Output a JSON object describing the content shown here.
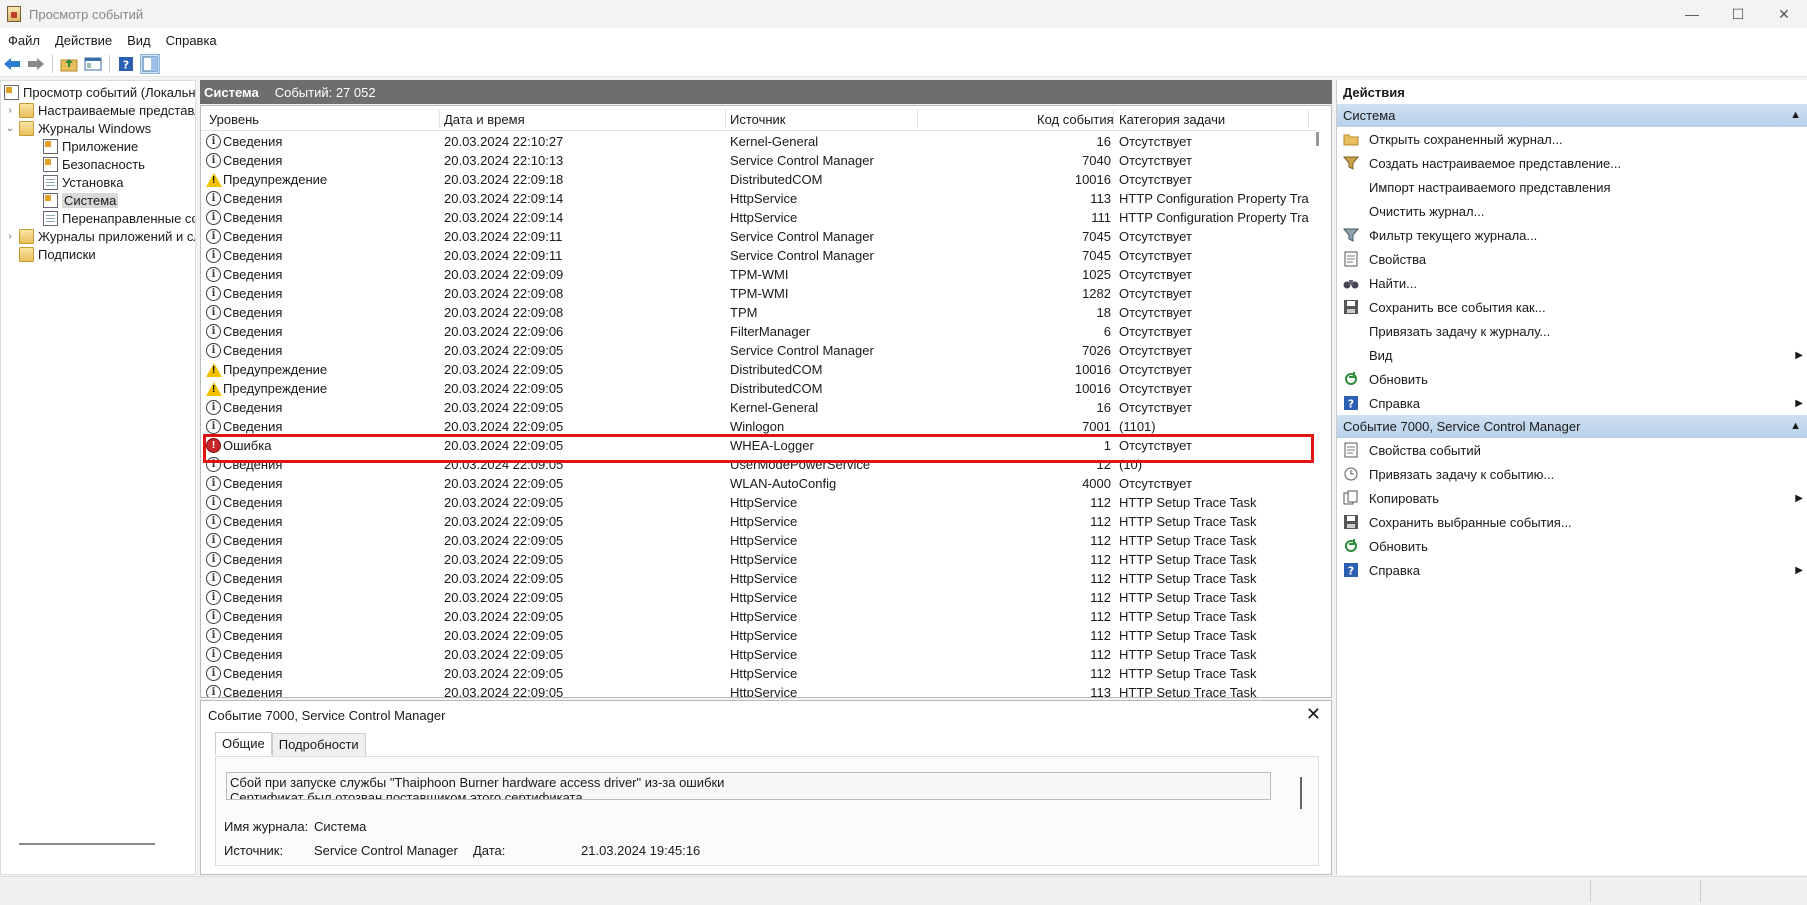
{
  "window": {
    "title": "Просмотр событий"
  },
  "window_controls": {
    "minimize": "—",
    "maximize": "☐",
    "close": "✕"
  },
  "menu": [
    "Файл",
    "Действие",
    "Вид",
    "Справка"
  ],
  "tree": {
    "items": [
      {
        "label": "Просмотр событий (Локальны",
        "level": 0,
        "arrow": "",
        "icon": "event-viewer-icon"
      },
      {
        "label": "Настраиваемые представле",
        "level": 1,
        "arrow": "›",
        "icon": "folder-icon"
      },
      {
        "label": "Журналы Windows",
        "level": 1,
        "arrow": "⌄",
        "icon": "folder-icon"
      },
      {
        "label": "Приложение",
        "level": 2,
        "arrow": "",
        "icon": "log-warning-icon"
      },
      {
        "label": "Безопасность",
        "level": 2,
        "arrow": "",
        "icon": "log-warning-icon"
      },
      {
        "label": "Установка",
        "level": 2,
        "arrow": "",
        "icon": "log-icon"
      },
      {
        "label": "Система",
        "level": 2,
        "arrow": "",
        "icon": "log-warning-icon",
        "selected": true
      },
      {
        "label": "Перенаправленные собы",
        "level": 2,
        "arrow": "",
        "icon": "log-icon"
      },
      {
        "label": "Журналы приложений и сл",
        "level": 1,
        "arrow": "›",
        "icon": "folder-icon"
      },
      {
        "label": "Подписки",
        "level": 1,
        "arrow": "",
        "icon": "folder-icon"
      }
    ]
  },
  "center": {
    "log_name": "Система",
    "count_text": "Событий: 27 052",
    "columns": [
      "Уровень",
      "Дата и время",
      "Источник",
      "Код события",
      "Категория задачи"
    ],
    "rows": [
      {
        "level": "info",
        "level_text": "Сведения",
        "date": "20.03.2024 22:10:27",
        "source": "Kernel-General",
        "id": "16",
        "category": "Отсутствует"
      },
      {
        "level": "info",
        "level_text": "Сведения",
        "date": "20.03.2024 22:10:13",
        "source": "Service Control Manager",
        "id": "7040",
        "category": "Отсутствует"
      },
      {
        "level": "warn",
        "level_text": "Предупреждение",
        "date": "20.03.2024 22:09:18",
        "source": "DistributedCOM",
        "id": "10016",
        "category": "Отсутствует"
      },
      {
        "level": "info",
        "level_text": "Сведения",
        "date": "20.03.2024 22:09:14",
        "source": "HttpService",
        "id": "113",
        "category": "HTTP Configuration Property Tra..."
      },
      {
        "level": "info",
        "level_text": "Сведения",
        "date": "20.03.2024 22:09:14",
        "source": "HttpService",
        "id": "111",
        "category": "HTTP Configuration Property Tra..."
      },
      {
        "level": "info",
        "level_text": "Сведения",
        "date": "20.03.2024 22:09:11",
        "source": "Service Control Manager",
        "id": "7045",
        "category": "Отсутствует"
      },
      {
        "level": "info",
        "level_text": "Сведения",
        "date": "20.03.2024 22:09:11",
        "source": "Service Control Manager",
        "id": "7045",
        "category": "Отсутствует"
      },
      {
        "level": "info",
        "level_text": "Сведения",
        "date": "20.03.2024 22:09:09",
        "source": "TPM-WMI",
        "id": "1025",
        "category": "Отсутствует"
      },
      {
        "level": "info",
        "level_text": "Сведения",
        "date": "20.03.2024 22:09:08",
        "source": "TPM-WMI",
        "id": "1282",
        "category": "Отсутствует"
      },
      {
        "level": "info",
        "level_text": "Сведения",
        "date": "20.03.2024 22:09:08",
        "source": "TPM",
        "id": "18",
        "category": "Отсутствует"
      },
      {
        "level": "info",
        "level_text": "Сведения",
        "date": "20.03.2024 22:09:06",
        "source": "FilterManager",
        "id": "6",
        "category": "Отсутствует"
      },
      {
        "level": "info",
        "level_text": "Сведения",
        "date": "20.03.2024 22:09:05",
        "source": "Service Control Manager",
        "id": "7026",
        "category": "Отсутствует"
      },
      {
        "level": "warn",
        "level_text": "Предупреждение",
        "date": "20.03.2024 22:09:05",
        "source": "DistributedCOM",
        "id": "10016",
        "category": "Отсутствует"
      },
      {
        "level": "warn",
        "level_text": "Предупреждение",
        "date": "20.03.2024 22:09:05",
        "source": "DistributedCOM",
        "id": "10016",
        "category": "Отсутствует"
      },
      {
        "level": "info",
        "level_text": "Сведения",
        "date": "20.03.2024 22:09:05",
        "source": "Kernel-General",
        "id": "16",
        "category": "Отсутствует"
      },
      {
        "level": "info",
        "level_text": "Сведения",
        "date": "20.03.2024 22:09:05",
        "source": "Winlogon",
        "id": "7001",
        "category": "(1101)"
      },
      {
        "level": "err",
        "level_text": "Ошибка",
        "date": "20.03.2024 22:09:05",
        "source": "WHEA-Logger",
        "id": "1",
        "category": "Отсутствует"
      },
      {
        "level": "info",
        "level_text": "Сведения",
        "date": "20.03.2024 22:09:05",
        "source": "UserModePowerService",
        "id": "12",
        "category": "(10)"
      },
      {
        "level": "info",
        "level_text": "Сведения",
        "date": "20.03.2024 22:09:05",
        "source": "WLAN-AutoConfig",
        "id": "4000",
        "category": "Отсутствует"
      },
      {
        "level": "info",
        "level_text": "Сведения",
        "date": "20.03.2024 22:09:05",
        "source": "HttpService",
        "id": "112",
        "category": "HTTP Setup Trace Task"
      },
      {
        "level": "info",
        "level_text": "Сведения",
        "date": "20.03.2024 22:09:05",
        "source": "HttpService",
        "id": "112",
        "category": "HTTP Setup Trace Task"
      },
      {
        "level": "info",
        "level_text": "Сведения",
        "date": "20.03.2024 22:09:05",
        "source": "HttpService",
        "id": "112",
        "category": "HTTP Setup Trace Task"
      },
      {
        "level": "info",
        "level_text": "Сведения",
        "date": "20.03.2024 22:09:05",
        "source": "HttpService",
        "id": "112",
        "category": "HTTP Setup Trace Task"
      },
      {
        "level": "info",
        "level_text": "Сведения",
        "date": "20.03.2024 22:09:05",
        "source": "HttpService",
        "id": "112",
        "category": "HTTP Setup Trace Task"
      },
      {
        "level": "info",
        "level_text": "Сведения",
        "date": "20.03.2024 22:09:05",
        "source": "HttpService",
        "id": "112",
        "category": "HTTP Setup Trace Task"
      },
      {
        "level": "info",
        "level_text": "Сведения",
        "date": "20.03.2024 22:09:05",
        "source": "HttpService",
        "id": "112",
        "category": "HTTP Setup Trace Task"
      },
      {
        "level": "info",
        "level_text": "Сведения",
        "date": "20.03.2024 22:09:05",
        "source": "HttpService",
        "id": "112",
        "category": "HTTP Setup Trace Task"
      },
      {
        "level": "info",
        "level_text": "Сведения",
        "date": "20.03.2024 22:09:05",
        "source": "HttpService",
        "id": "112",
        "category": "HTTP Setup Trace Task"
      },
      {
        "level": "info",
        "level_text": "Сведения",
        "date": "20.03.2024 22:09:05",
        "source": "HttpService",
        "id": "112",
        "category": "HTTP Setup Trace Task"
      },
      {
        "level": "info",
        "level_text": "Сведения",
        "date": "20.03.2024 22:09:05",
        "source": "HttpService",
        "id": "113",
        "category": "HTTP Setup Trace Task"
      }
    ]
  },
  "detail": {
    "title": "Событие 7000, Service Control Manager",
    "close": "✕",
    "tabs": [
      "Общие",
      "Подробности"
    ],
    "message_line1": "Сбой при запуске службы \"Thaiphoon Burner hardware access driver\" из-за ошибки",
    "message_line2": "Сертификат был отозван поставщиком этого сертификата",
    "journal_label": "Имя журнала:",
    "journal_value": "Система",
    "source_label": "Источник:",
    "source_value": "Service Control Manager",
    "date_label": "Дата:",
    "date_value": "21.03.2024 19:45:16"
  },
  "actions": {
    "title": "Действия",
    "sections": [
      {
        "name": "Система",
        "items": [
          {
            "label": "Открыть сохраненный журнал...",
            "icon": "open-folder-icon",
            "submenu": false
          },
          {
            "label": "Создать настраиваемое представление...",
            "icon": "filter-create-icon",
            "submenu": false
          },
          {
            "label": "Импорт настраиваемого представления",
            "icon": "",
            "submenu": false
          },
          {
            "label": "Очистить журнал...",
            "icon": "",
            "submenu": false
          },
          {
            "label": "Фильтр текущего журнала...",
            "icon": "filter-icon",
            "submenu": false
          },
          {
            "label": "Свойства",
            "icon": "properties-icon",
            "submenu": false
          },
          {
            "label": "Найти...",
            "icon": "binoculars-icon",
            "submenu": false
          },
          {
            "label": "Сохранить все события как...",
            "icon": "save-icon",
            "submenu": false
          },
          {
            "label": "Привязать задачу к журналу...",
            "icon": "",
            "submenu": false
          },
          {
            "label": "Вид",
            "icon": "",
            "submenu": true
          },
          {
            "label": "Обновить",
            "icon": "refresh-icon",
            "submenu": false
          },
          {
            "label": "Справка",
            "icon": "help-icon",
            "submenu": true
          }
        ]
      },
      {
        "name": "Событие 7000, Service Control Manager",
        "items": [
          {
            "label": "Свойства событий",
            "icon": "properties-icon",
            "submenu": false
          },
          {
            "label": "Привязать задачу к событию...",
            "icon": "task-icon",
            "submenu": false
          },
          {
            "label": "Копировать",
            "icon": "copy-icon",
            "submenu": true
          },
          {
            "label": "Сохранить выбранные события...",
            "icon": "save-icon",
            "submenu": false
          },
          {
            "label": "Обновить",
            "icon": "refresh-icon",
            "submenu": false
          },
          {
            "label": "Справка",
            "icon": "help-icon",
            "submenu": true
          }
        ]
      }
    ]
  }
}
